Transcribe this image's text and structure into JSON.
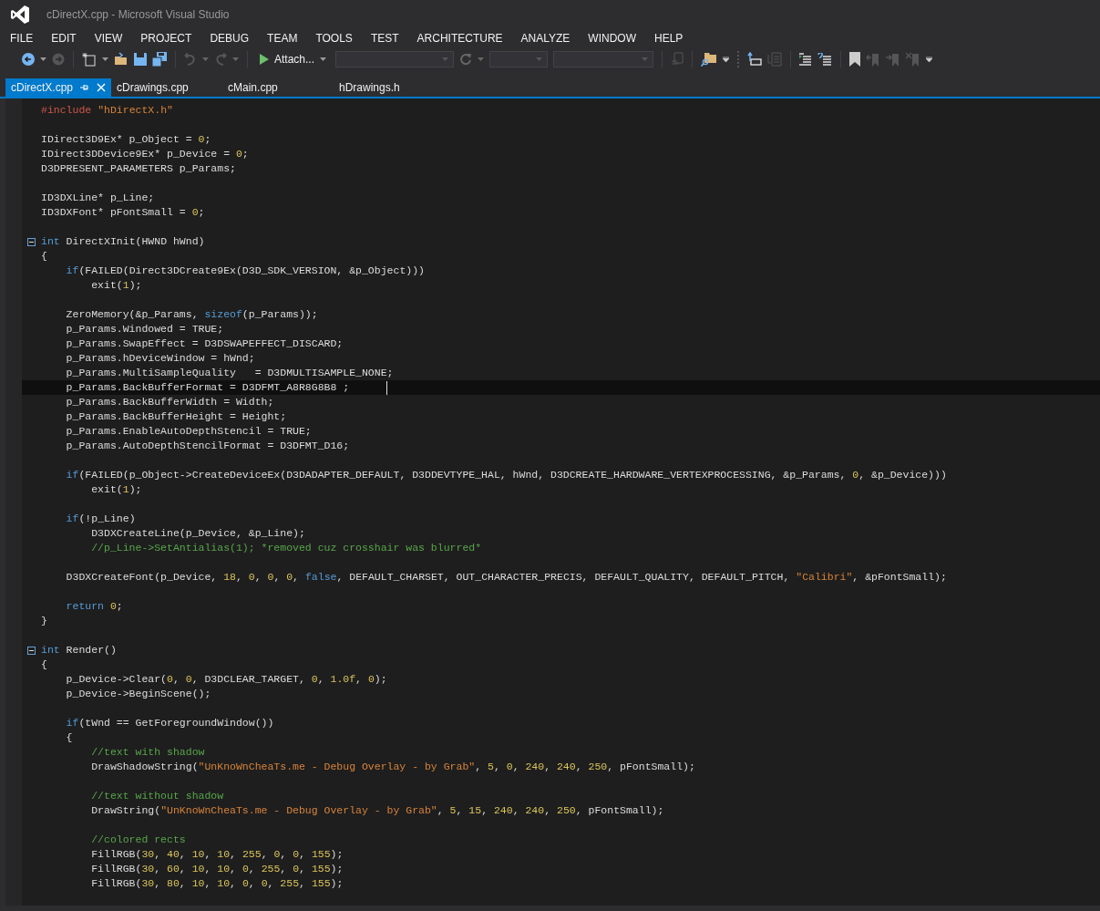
{
  "window": {
    "title": "cDirectX.cpp - Microsoft Visual Studio"
  },
  "menu": [
    "FILE",
    "EDIT",
    "VIEW",
    "PROJECT",
    "DEBUG",
    "TEAM",
    "TOOLS",
    "TEST",
    "ARCHITECTURE",
    "ANALYZE",
    "WINDOW",
    "HELP"
  ],
  "toolbar": {
    "attach_button": "Attach..."
  },
  "tabs": [
    {
      "label": "cDirectX.cpp",
      "selected": true
    },
    {
      "label": "cDrawings.cpp",
      "selected": false
    },
    {
      "label": "cMain.cpp",
      "selected": false
    },
    {
      "label": "hDrawings.h",
      "selected": false
    }
  ],
  "code": [
    {
      "kind": "code",
      "tokens": [
        {
          "kind": "pre",
          "text": "#include "
        },
        {
          "kind": "str",
          "text": "\"hDirectX.h\""
        }
      ]
    },
    {
      "kind": "blank"
    },
    {
      "kind": "code",
      "tokens": [
        {
          "kind": "plain",
          "text": "IDirect3D9Ex* p_Object = "
        },
        {
          "kind": "num",
          "text": "0"
        },
        {
          "kind": "plain",
          "text": ";"
        }
      ]
    },
    {
      "kind": "code",
      "tokens": [
        {
          "kind": "plain",
          "text": "IDirect3DDevice9Ex* p_Device = "
        },
        {
          "kind": "num",
          "text": "0"
        },
        {
          "kind": "plain",
          "text": ";"
        }
      ]
    },
    {
      "kind": "code",
      "tokens": [
        {
          "kind": "plain",
          "text": "D3DPRESENT_PARAMETERS p_Params;"
        }
      ]
    },
    {
      "kind": "blank"
    },
    {
      "kind": "code",
      "tokens": [
        {
          "kind": "plain",
          "text": "ID3DXLine* p_Line;"
        }
      ]
    },
    {
      "kind": "code",
      "tokens": [
        {
          "kind": "plain",
          "text": "ID3DXFont* pFontSmall = "
        },
        {
          "kind": "num",
          "text": "0"
        },
        {
          "kind": "plain",
          "text": ";"
        }
      ]
    },
    {
      "kind": "blank"
    },
    {
      "kind": "code",
      "fold": {
        "expanded": true
      },
      "tokens": [
        {
          "kind": "kw",
          "text": "int"
        },
        {
          "kind": "plain",
          "text": " DirectXInit(HWND hWnd)"
        }
      ]
    },
    {
      "kind": "code",
      "tokens": [
        {
          "kind": "plain",
          "text": "{"
        }
      ]
    },
    {
      "kind": "code",
      "tokens": [
        {
          "kind": "kw",
          "text": "    if"
        },
        {
          "kind": "plain",
          "text": "(FAILED(Direct3DCreate9Ex(D3D_SDK_VERSION, &p_Object)))"
        }
      ]
    },
    {
      "kind": "code",
      "tokens": [
        {
          "kind": "plain",
          "text": "        exit("
        },
        {
          "kind": "num",
          "text": "1"
        },
        {
          "kind": "plain",
          "text": ");"
        }
      ]
    },
    {
      "kind": "blank"
    },
    {
      "kind": "code",
      "tokens": [
        {
          "kind": "plain",
          "text": "    ZeroMemory(&p_Params, "
        },
        {
          "kind": "kw",
          "text": "sizeof"
        },
        {
          "kind": "plain",
          "text": "(p_Params));"
        }
      ]
    },
    {
      "kind": "code",
      "tokens": [
        {
          "kind": "plain",
          "text": "    p_Params.Windowed = TRUE;"
        }
      ]
    },
    {
      "kind": "code",
      "tokens": [
        {
          "kind": "plain",
          "text": "    p_Params.SwapEffect = D3DSWAPEFFECT_DISCARD;"
        }
      ]
    },
    {
      "kind": "code",
      "tokens": [
        {
          "kind": "plain",
          "text": "    p_Params.hDeviceWindow = hWnd;"
        }
      ]
    },
    {
      "kind": "code",
      "tokens": [
        {
          "kind": "plain",
          "text": "    p_Params.MultiSampleQuality   = D3DMULTISAMPLE_NONE;"
        }
      ]
    },
    {
      "kind": "code",
      "current": true,
      "tokens": [
        {
          "kind": "plain",
          "text": "    p_Params.BackBufferFormat = D3DFMT_A8R8G8B8 ;"
        }
      ]
    },
    {
      "kind": "code",
      "tokens": [
        {
          "kind": "plain",
          "text": "    p_Params.BackBufferWidth = Width;"
        }
      ]
    },
    {
      "kind": "code",
      "tokens": [
        {
          "kind": "plain",
          "text": "    p_Params.BackBufferHeight = Height;"
        }
      ]
    },
    {
      "kind": "code",
      "tokens": [
        {
          "kind": "plain",
          "text": "    p_Params.EnableAutoDepthStencil = TRUE;"
        }
      ]
    },
    {
      "kind": "code",
      "tokens": [
        {
          "kind": "plain",
          "text": "    p_Params.AutoDepthStencilFormat = D3DFMT_D16;"
        }
      ]
    },
    {
      "kind": "blank"
    },
    {
      "kind": "code",
      "tokens": [
        {
          "kind": "kw",
          "text": "    if"
        },
        {
          "kind": "plain",
          "text": "(FAILED(p_Object->CreateDeviceEx(D3DADAPTER_DEFAULT, D3DDEVTYPE_HAL, hWnd, D3DCREATE_HARDWARE_VERTEXPROCESSING, &p_Params, "
        },
        {
          "kind": "num",
          "text": "0"
        },
        {
          "kind": "plain",
          "text": ", &p_Device)))"
        }
      ]
    },
    {
      "kind": "code",
      "tokens": [
        {
          "kind": "plain",
          "text": "        exit("
        },
        {
          "kind": "num",
          "text": "1"
        },
        {
          "kind": "plain",
          "text": ");"
        }
      ]
    },
    {
      "kind": "blank"
    },
    {
      "kind": "code",
      "tokens": [
        {
          "kind": "kw",
          "text": "    if"
        },
        {
          "kind": "plain",
          "text": "(!p_Line)"
        }
      ]
    },
    {
      "kind": "code",
      "tokens": [
        {
          "kind": "plain",
          "text": "        D3DXCreateLine(p_Device, &p_Line);"
        }
      ]
    },
    {
      "kind": "code",
      "tokens": [
        {
          "kind": "comment",
          "text": "        //p_Line->SetAntialias(1); *removed cuz crosshair was blurred*"
        }
      ]
    },
    {
      "kind": "blank"
    },
    {
      "kind": "code",
      "tokens": [
        {
          "kind": "plain",
          "text": "    D3DXCreateFont(p_Device, "
        },
        {
          "kind": "num",
          "text": "18"
        },
        {
          "kind": "plain",
          "text": ", "
        },
        {
          "kind": "num",
          "text": "0"
        },
        {
          "kind": "plain",
          "text": ", "
        },
        {
          "kind": "num",
          "text": "0"
        },
        {
          "kind": "plain",
          "text": ", "
        },
        {
          "kind": "num",
          "text": "0"
        },
        {
          "kind": "plain",
          "text": ", "
        },
        {
          "kind": "kw",
          "text": "false"
        },
        {
          "kind": "plain",
          "text": ", DEFAULT_CHARSET, OUT_CHARACTER_PRECIS, DEFAULT_QUALITY, DEFAULT_PITCH, "
        },
        {
          "kind": "str",
          "text": "\"Calibri\""
        },
        {
          "kind": "plain",
          "text": ", &pFontSmall);"
        }
      ]
    },
    {
      "kind": "blank"
    },
    {
      "kind": "code",
      "tokens": [
        {
          "kind": "kw",
          "text": "    return"
        },
        {
          "kind": "num",
          "text": " 0"
        },
        {
          "kind": "plain",
          "text": ";"
        }
      ]
    },
    {
      "kind": "code",
      "tokens": [
        {
          "kind": "plain",
          "text": "}"
        }
      ]
    },
    {
      "kind": "blank"
    },
    {
      "kind": "code",
      "fold": {
        "expanded": true
      },
      "tokens": [
        {
          "kind": "kw",
          "text": "int"
        },
        {
          "kind": "plain",
          "text": " Render()"
        }
      ]
    },
    {
      "kind": "code",
      "tokens": [
        {
          "kind": "plain",
          "text": "{"
        }
      ]
    },
    {
      "kind": "code",
      "tokens": [
        {
          "kind": "plain",
          "text": "    p_Device->Clear("
        },
        {
          "kind": "num",
          "text": "0"
        },
        {
          "kind": "plain",
          "text": ", "
        },
        {
          "kind": "num",
          "text": "0"
        },
        {
          "kind": "plain",
          "text": ", D3DCLEAR_TARGET, "
        },
        {
          "kind": "num",
          "text": "0"
        },
        {
          "kind": "plain",
          "text": ", "
        },
        {
          "kind": "num",
          "text": "1.0f"
        },
        {
          "kind": "plain",
          "text": ", "
        },
        {
          "kind": "num",
          "text": "0"
        },
        {
          "kind": "plain",
          "text": ");"
        }
      ]
    },
    {
      "kind": "code",
      "tokens": [
        {
          "kind": "plain",
          "text": "    p_Device->BeginScene();"
        }
      ]
    },
    {
      "kind": "blank"
    },
    {
      "kind": "code",
      "tokens": [
        {
          "kind": "kw",
          "text": "    if"
        },
        {
          "kind": "plain",
          "text": "(tWnd == GetForegroundWindow())"
        }
      ]
    },
    {
      "kind": "code",
      "tokens": [
        {
          "kind": "plain",
          "text": "    {"
        }
      ]
    },
    {
      "kind": "code",
      "tokens": [
        {
          "kind": "comment",
          "text": "        //text with shadow"
        }
      ]
    },
    {
      "kind": "code",
      "tokens": [
        {
          "kind": "plain",
          "text": "        DrawShadowString("
        },
        {
          "kind": "str",
          "text": "\"UnKnoWnCheaTs.me - Debug Overlay - by Grab\""
        },
        {
          "kind": "plain",
          "text": ", "
        },
        {
          "kind": "num",
          "text": "5"
        },
        {
          "kind": "plain",
          "text": ", "
        },
        {
          "kind": "num",
          "text": "0"
        },
        {
          "kind": "plain",
          "text": ", "
        },
        {
          "kind": "num",
          "text": "240"
        },
        {
          "kind": "plain",
          "text": ", "
        },
        {
          "kind": "num",
          "text": "240"
        },
        {
          "kind": "plain",
          "text": ", "
        },
        {
          "kind": "num",
          "text": "250"
        },
        {
          "kind": "plain",
          "text": ", pFontSmall);"
        }
      ]
    },
    {
      "kind": "blank"
    },
    {
      "kind": "code",
      "tokens": [
        {
          "kind": "comment",
          "text": "        //text without shadow"
        }
      ]
    },
    {
      "kind": "code",
      "tokens": [
        {
          "kind": "plain",
          "text": "        DrawString("
        },
        {
          "kind": "str",
          "text": "\"UnKnoWnCheaTs.me - Debug Overlay - by Grab\""
        },
        {
          "kind": "plain",
          "text": ", "
        },
        {
          "kind": "num",
          "text": "5"
        },
        {
          "kind": "plain",
          "text": ", "
        },
        {
          "kind": "num",
          "text": "15"
        },
        {
          "kind": "plain",
          "text": ", "
        },
        {
          "kind": "num",
          "text": "240"
        },
        {
          "kind": "plain",
          "text": ", "
        },
        {
          "kind": "num",
          "text": "240"
        },
        {
          "kind": "plain",
          "text": ", "
        },
        {
          "kind": "num",
          "text": "250"
        },
        {
          "kind": "plain",
          "text": ", pFontSmall);"
        }
      ]
    },
    {
      "kind": "blank"
    },
    {
      "kind": "code",
      "tokens": [
        {
          "kind": "comment",
          "text": "        //colored rects"
        }
      ]
    },
    {
      "kind": "code",
      "tokens": [
        {
          "kind": "plain",
          "text": "        FillRGB("
        },
        {
          "kind": "num",
          "text": "30"
        },
        {
          "kind": "plain",
          "text": ", "
        },
        {
          "kind": "num",
          "text": "40"
        },
        {
          "kind": "plain",
          "text": ", "
        },
        {
          "kind": "num",
          "text": "10"
        },
        {
          "kind": "plain",
          "text": ", "
        },
        {
          "kind": "num",
          "text": "10"
        },
        {
          "kind": "plain",
          "text": ", "
        },
        {
          "kind": "num",
          "text": "255"
        },
        {
          "kind": "plain",
          "text": ", "
        },
        {
          "kind": "num",
          "text": "0"
        },
        {
          "kind": "plain",
          "text": ", "
        },
        {
          "kind": "num",
          "text": "0"
        },
        {
          "kind": "plain",
          "text": ", "
        },
        {
          "kind": "num",
          "text": "155"
        },
        {
          "kind": "plain",
          "text": ");"
        }
      ]
    },
    {
      "kind": "code",
      "tokens": [
        {
          "kind": "plain",
          "text": "        FillRGB("
        },
        {
          "kind": "num",
          "text": "30"
        },
        {
          "kind": "plain",
          "text": ", "
        },
        {
          "kind": "num",
          "text": "60"
        },
        {
          "kind": "plain",
          "text": ", "
        },
        {
          "kind": "num",
          "text": "10"
        },
        {
          "kind": "plain",
          "text": ", "
        },
        {
          "kind": "num",
          "text": "10"
        },
        {
          "kind": "plain",
          "text": ", "
        },
        {
          "kind": "num",
          "text": "0"
        },
        {
          "kind": "plain",
          "text": ", "
        },
        {
          "kind": "num",
          "text": "255"
        },
        {
          "kind": "plain",
          "text": ", "
        },
        {
          "kind": "num",
          "text": "0"
        },
        {
          "kind": "plain",
          "text": ", "
        },
        {
          "kind": "num",
          "text": "155"
        },
        {
          "kind": "plain",
          "text": ");"
        }
      ]
    },
    {
      "kind": "code",
      "tokens": [
        {
          "kind": "plain",
          "text": "        FillRGB("
        },
        {
          "kind": "num",
          "text": "30"
        },
        {
          "kind": "plain",
          "text": ", "
        },
        {
          "kind": "num",
          "text": "80"
        },
        {
          "kind": "plain",
          "text": ", "
        },
        {
          "kind": "num",
          "text": "10"
        },
        {
          "kind": "plain",
          "text": ", "
        },
        {
          "kind": "num",
          "text": "10"
        },
        {
          "kind": "plain",
          "text": ", "
        },
        {
          "kind": "num",
          "text": "0"
        },
        {
          "kind": "plain",
          "text": ", "
        },
        {
          "kind": "num",
          "text": "0"
        },
        {
          "kind": "plain",
          "text": ", "
        },
        {
          "kind": "num",
          "text": "255"
        },
        {
          "kind": "plain",
          "text": ", "
        },
        {
          "kind": "num",
          "text": "155"
        },
        {
          "kind": "plain",
          "text": ");"
        }
      ]
    },
    {
      "kind": "blank"
    }
  ]
}
